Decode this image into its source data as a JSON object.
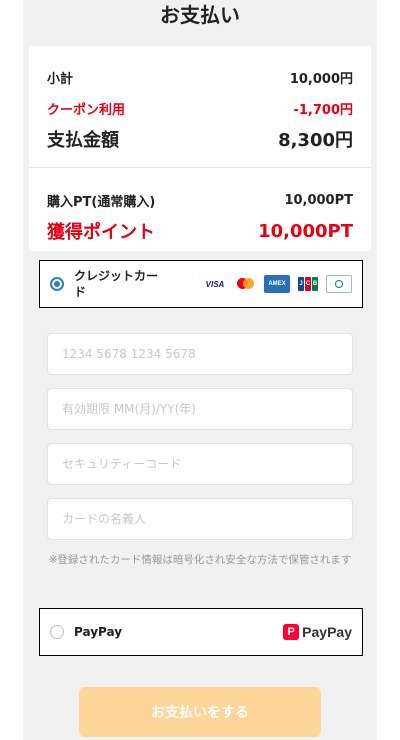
{
  "header": {
    "title": "お支払い"
  },
  "summary": {
    "subtotal_label": "小計",
    "subtotal_value": "10,000円",
    "coupon_label": "クーポン利用",
    "coupon_value": "-1,700円",
    "total_label": "支払金額",
    "total_value": "8,300円",
    "points_label": "購入PT(通常購入)",
    "points_value": "10,000PT",
    "earned_label": "獲得ポイント",
    "earned_value": "10,000PT"
  },
  "payment": {
    "credit_card": {
      "label": "クレジットカード",
      "selected": true,
      "brands": [
        "VISA",
        "Mastercard",
        "AMEX",
        "JCB",
        "Diners Club"
      ]
    },
    "fields": {
      "card_number_placeholder": "1234 5678 1234 5678",
      "expiry_placeholder": "有効期限 MM(月)/YY(年)",
      "security_code_placeholder": "セキュリティーコード",
      "card_holder_placeholder": "カードの名義人"
    },
    "note": "※登録されたカード情報は暗号化され安全な方法で保管されます",
    "paypay": {
      "label": "PayPay",
      "logo_text": "PayPay",
      "selected": false
    }
  },
  "submit_label": "お支払いをする",
  "colors": {
    "accent_red": "#e60012",
    "radio_blue": "#2e7bd6",
    "submit_bg": "#fdd59a",
    "paypay_red": "#ff0033"
  }
}
